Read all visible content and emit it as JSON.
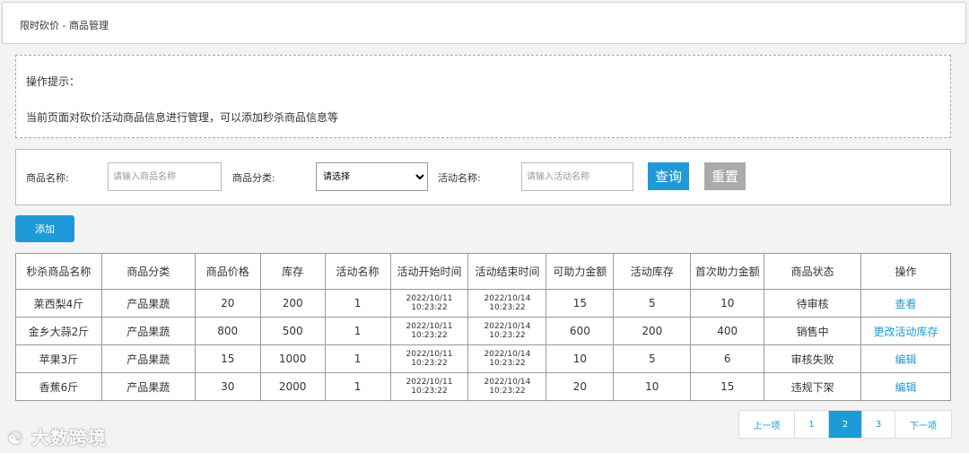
{
  "header": {
    "breadcrumb": "限时砍价 - 商品管理"
  },
  "tips": {
    "title": "操作提示：",
    "description": "当前页面对砍价活动商品信息进行管理，可以添加秒杀商品信息等"
  },
  "search": {
    "product_name_label": "商品名称:",
    "product_name_placeholder": "请输入商品名称",
    "category_label": "商品分类:",
    "category_selected": "请选择",
    "activity_name_label": "活动名称:",
    "activity_name_placeholder": "请输入活动名称",
    "query_button": "查询",
    "reset_button": "重置"
  },
  "toolbar": {
    "add_button": "添加"
  },
  "table": {
    "headers": [
      "秒杀商品名称",
      "商品分类",
      "商品价格",
      "库存",
      "活动名称",
      "活动开始时间",
      "活动结束时间",
      "可助力金额",
      "活动库存",
      "首次助力金额",
      "商品状态",
      "操作"
    ],
    "rows": [
      {
        "name": "莱西梨4斤",
        "category": "产品果蔬",
        "price": "20",
        "stock": "200",
        "activity": "1",
        "start_date": "2022/10/11",
        "start_time": "10:23:22",
        "end_date": "2022/10/14",
        "end_time": "10:23:22",
        "assist_amount": "15",
        "activity_stock": "5",
        "first_assist": "10",
        "status": "待审核",
        "action": "查看"
      },
      {
        "name": "金乡大蒜2斤",
        "category": "产品果蔬",
        "price": "800",
        "stock": "500",
        "activity": "1",
        "start_date": "2022/10/11",
        "start_time": "10:23:22",
        "end_date": "2022/10/14",
        "end_time": "10:23:22",
        "assist_amount": "600",
        "activity_stock": "200",
        "first_assist": "400",
        "status": "销售中",
        "action": "更改活动库存"
      },
      {
        "name": "苹果3斤",
        "category": "产品果蔬",
        "price": "15",
        "stock": "1000",
        "activity": "1",
        "start_date": "2022/10/11",
        "start_time": "10:23:22",
        "end_date": "2022/10/14",
        "end_time": "10:23:22",
        "assist_amount": "10",
        "activity_stock": "5",
        "first_assist": "6",
        "status": "审核失败",
        "action": "编辑"
      },
      {
        "name": "香蕉6斤",
        "category": "产品果蔬",
        "price": "30",
        "stock": "2000",
        "activity": "1",
        "start_date": "2022/10/11",
        "start_time": "10:23:22",
        "end_date": "2022/10/14",
        "end_time": "10:23:22",
        "assist_amount": "20",
        "activity_stock": "10",
        "first_assist": "15",
        "status": "违规下架",
        "action": "编辑"
      }
    ]
  },
  "pagination": {
    "prev": "上一项",
    "pages": [
      "1",
      "2",
      "3"
    ],
    "current": "2",
    "next": "下一项"
  },
  "watermark": "大数跨境",
  "colors": {
    "accent": "#1e9ad6",
    "reset_gray": "#aaaaaa"
  }
}
